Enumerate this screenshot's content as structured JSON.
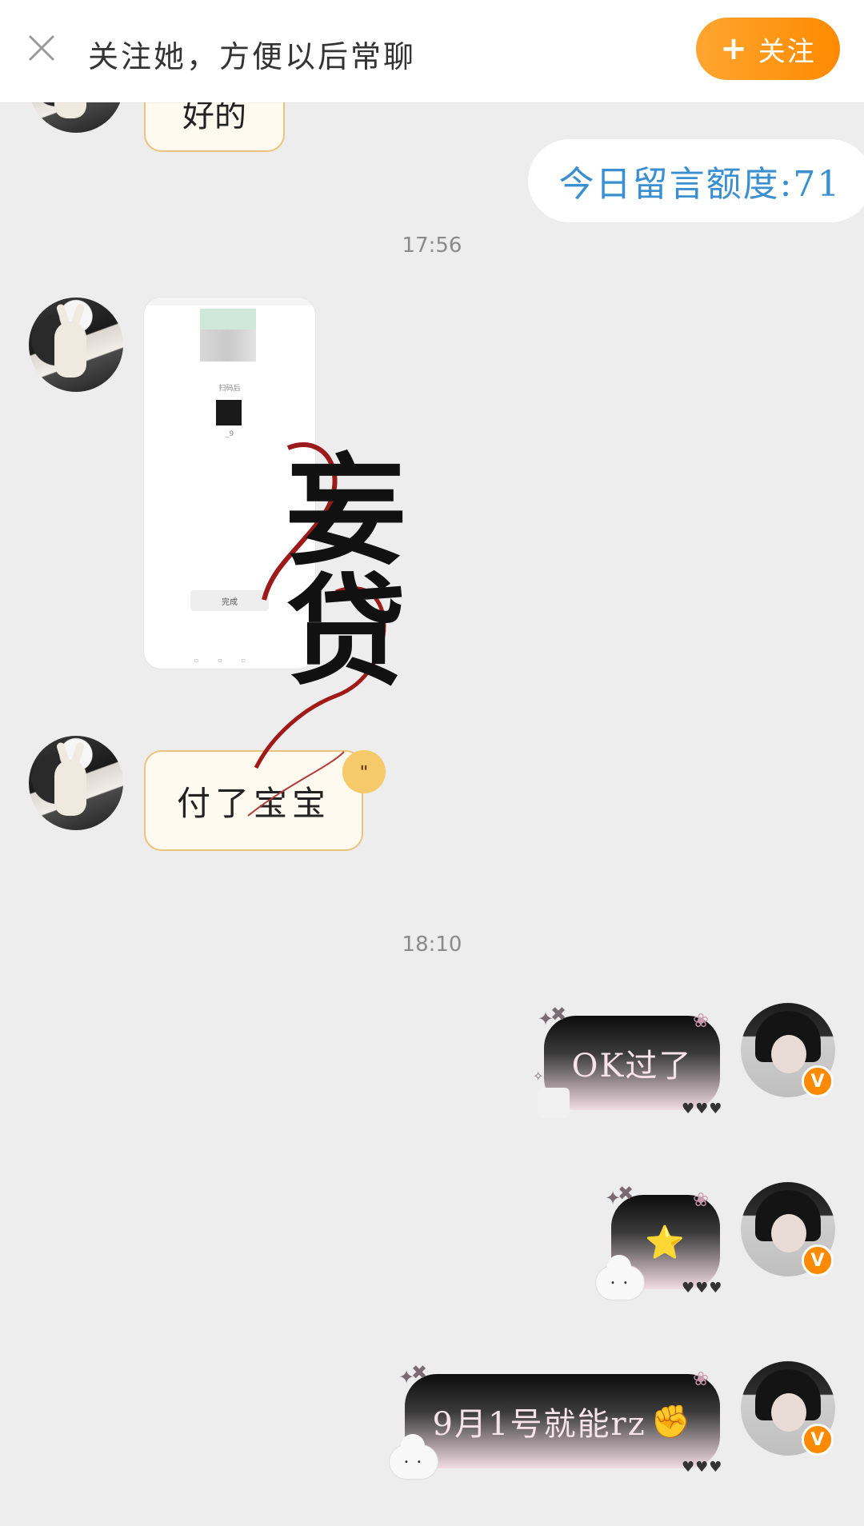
{
  "topbar": {
    "prompt_text": "关注她，方便以后常聊",
    "follow_plus": "+",
    "follow_label": "关注"
  },
  "messages": {
    "partial_top_text": "好的",
    "quota_text": "今日留言额度:71",
    "time_1": "17:56",
    "image_msg": {
      "top_caption": "扫码后",
      "qr_caption": "_9",
      "done_label": "完成"
    },
    "paid_text": "付了宝宝",
    "time_2": "18:10",
    "ok_text": "OK过了",
    "star_emoji": "⭐",
    "rz_text": "9月1号就能rz",
    "fist_emoji": "✊"
  },
  "badge": {
    "verified_letter": "V"
  },
  "watermark_text": "妄贷",
  "colors": {
    "accent": "#ff8a00",
    "quota_text": "#3a8fd0",
    "bubble_border": "#e9c47a"
  }
}
